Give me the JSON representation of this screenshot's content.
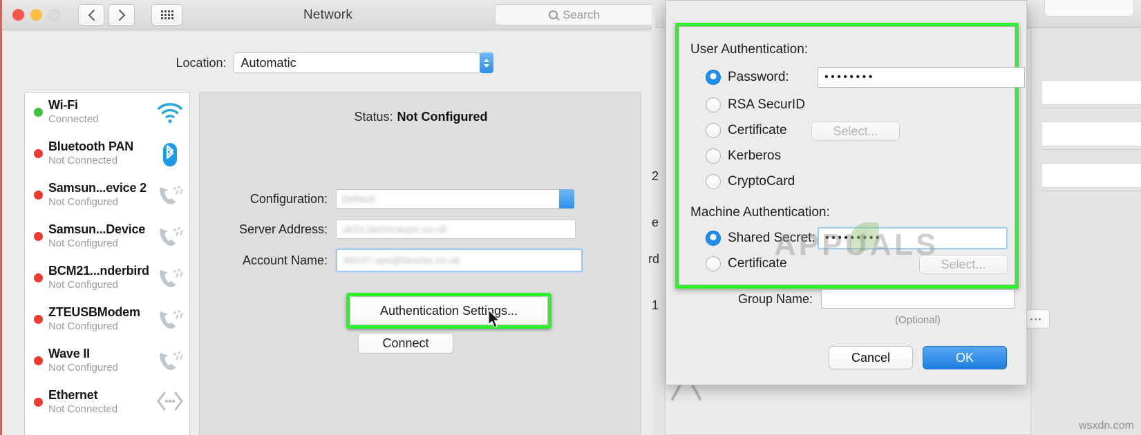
{
  "network_window": {
    "title": "Network",
    "search": {
      "placeholder": "Search",
      "icon": "search-icon"
    },
    "traffic_lights": [
      "close",
      "minimize",
      "zoom"
    ],
    "location": {
      "label": "Location:",
      "value": "Automatic"
    },
    "services": [
      {
        "name": "Wi-Fi",
        "status": "Connected",
        "led": "green",
        "icon": "wifi-icon"
      },
      {
        "name": "Bluetooth PAN",
        "status": "Not Connected",
        "led": "red",
        "icon": "bluetooth-icon"
      },
      {
        "name": "Samsun...evice 2",
        "status": "Not Configured",
        "led": "red",
        "icon": "modem-icon"
      },
      {
        "name": "Samsun...Device",
        "status": "Not Configured",
        "led": "red",
        "icon": "modem-icon"
      },
      {
        "name": "BCM21...nderbird",
        "status": "Not Configured",
        "led": "red",
        "icon": "modem-icon"
      },
      {
        "name": "ZTEUSBModem",
        "status": "Not Configured",
        "led": "red",
        "icon": "modem-icon"
      },
      {
        "name": "Wave II",
        "status": "Not Configured",
        "led": "red",
        "icon": "modem-icon"
      },
      {
        "name": "Ethernet",
        "status": "Not Connected",
        "led": "red",
        "icon": "ethernet-icon"
      }
    ],
    "detail": {
      "status_label": "Status:",
      "status_value": "Not Configured",
      "fields": [
        {
          "label": "Configuration:",
          "value": "Default",
          "redacted": true,
          "has_stepper": true
        },
        {
          "label": "Server Address:",
          "value": "uk2s.lanmicavpn.co.uk",
          "redacted": true,
          "has_stepper": false
        },
        {
          "label": "Account Name:",
          "value": "48147.vpn@lanmia.co.uk",
          "redacted": true,
          "has_stepper": false,
          "focused": true
        }
      ],
      "auth_settings_button": "Authentication Settings...",
      "connect_button": "Connect"
    }
  },
  "background_window": {
    "title": "Network",
    "fragments": [
      "2",
      "e",
      "rd",
      "1"
    ]
  },
  "auth_dialog": {
    "user_auth_title": "User Authentication:",
    "user_options": [
      {
        "label": "Password:",
        "selected": true,
        "has_field": true,
        "field_value": "••••••••"
      },
      {
        "label": "RSA SecurID",
        "selected": false,
        "has_field": false
      },
      {
        "label": "Certificate",
        "selected": false,
        "has_field": false,
        "button": "Select..."
      },
      {
        "label": "Kerberos",
        "selected": false,
        "has_field": false
      },
      {
        "label": "CryptoCard",
        "selected": false,
        "has_field": false
      }
    ],
    "machine_auth_title": "Machine Authentication:",
    "machine_options": [
      {
        "label": "Shared Secret:",
        "selected": true,
        "has_field": true,
        "field_value": "•••••••••"
      },
      {
        "label": "Certificate",
        "selected": false,
        "has_field": false,
        "button": "Select..."
      }
    ],
    "group_name_label": "Group Name:",
    "group_name_value": "",
    "optional_hint": "(Optional)",
    "cancel_button": "Cancel",
    "ok_button": "OK"
  },
  "watermarks": {
    "brand": "APPUALS",
    "site": "wsxdn.com"
  },
  "colors": {
    "highlight_green": "#2bf22b",
    "accent_blue": "#1e8ff0",
    "led_green": "#3ec23e",
    "led_red": "#ee3b30"
  }
}
